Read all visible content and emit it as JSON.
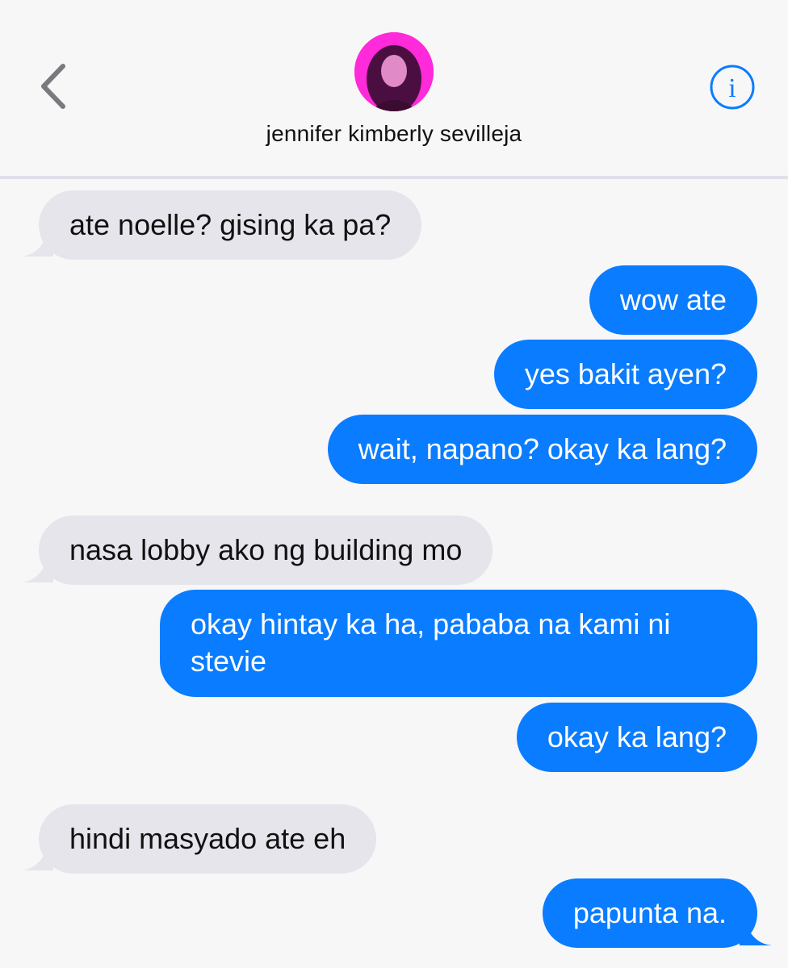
{
  "header": {
    "contact_name": "jennifer kimberly sevilleja",
    "back_icon": "chevron-left-icon",
    "info_icon": "info-icon",
    "accent_color": "#0a7cff"
  },
  "messages": [
    {
      "direction": "incoming",
      "text": "ate noelle? gising ka pa?"
    },
    {
      "direction": "outgoing",
      "text": "wow ate"
    },
    {
      "direction": "outgoing",
      "text": "yes bakit ayen?"
    },
    {
      "direction": "outgoing",
      "text": "wait, napano? okay ka lang?"
    },
    {
      "direction": "incoming",
      "text": "nasa lobby ako ng building mo"
    },
    {
      "direction": "outgoing",
      "text": "okay hintay ka ha, pababa na kami ni stevie"
    },
    {
      "direction": "outgoing",
      "text": "okay ka lang?"
    },
    {
      "direction": "incoming",
      "text": "hindi masyado ate eh"
    },
    {
      "direction": "outgoing",
      "text": "papunta na."
    }
  ],
  "colors": {
    "incoming_bubble": "#e6e5eb",
    "outgoing_bubble": "#0a7cff",
    "avatar_bg": "#ff2ad9"
  }
}
